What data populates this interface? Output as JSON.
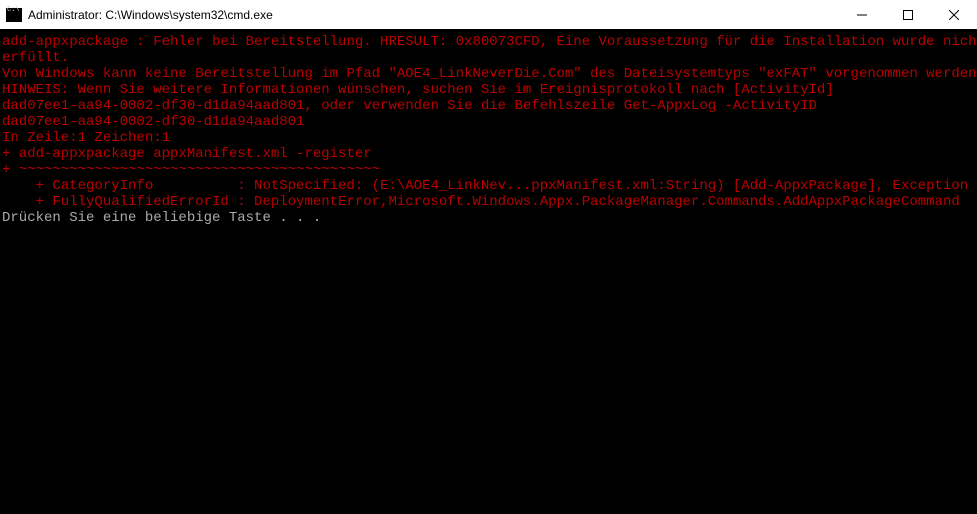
{
  "titlebar": {
    "title": "Administrator: C:\\Windows\\system32\\cmd.exe"
  },
  "terminal": {
    "lines": [
      {
        "cls": "err",
        "text": "add-appxpackage : Fehler bei Bereitstellung. HRESULT: 0x80073CFD, Eine Voraussetzung für die Installation wurde nicht"
      },
      {
        "cls": "err",
        "text": "erfüllt."
      },
      {
        "cls": "err",
        "text": "Von Windows kann keine Bereitstellung im Pfad \"AOE4_LinkNeverDie.Com\" des Dateisystemtyps \"exFAT\" vorgenommen werden."
      },
      {
        "cls": "err",
        "text": "HINWEIS: Wenn Sie weitere Informationen wünschen, suchen Sie im Ereignisprotokoll nach [ActivityId]"
      },
      {
        "cls": "err",
        "text": "dad07ee1-aa94-0002-df30-d1da94aad801, oder verwenden Sie die Befehlszeile Get-AppxLog -ActivityID"
      },
      {
        "cls": "err",
        "text": "dad07ee1-aa94-0002-df30-d1da94aad801"
      },
      {
        "cls": "err",
        "text": "In Zeile:1 Zeichen:1"
      },
      {
        "cls": "err",
        "text": "+ add-appxpackage appxManifest.xml -register"
      },
      {
        "cls": "err",
        "text": "+ ~~~~~~~~~~~~~~~~~~~~~~~~~~~~~~~~~~~~~~~~~~~"
      },
      {
        "cls": "err",
        "text": "    + CategoryInfo          : NotSpecified: (E:\\AOE4_LinkNev...ppxManifest.xml:String) [Add-AppxPackage], Exception"
      },
      {
        "cls": "err",
        "text": "    + FullyQualifiedErrorId : DeploymentError,Microsoft.Windows.Appx.PackageManager.Commands.AddAppxPackageCommand"
      },
      {
        "cls": "err",
        "text": ""
      },
      {
        "cls": "prompt",
        "text": "Drücken Sie eine beliebige Taste . . ."
      }
    ]
  }
}
